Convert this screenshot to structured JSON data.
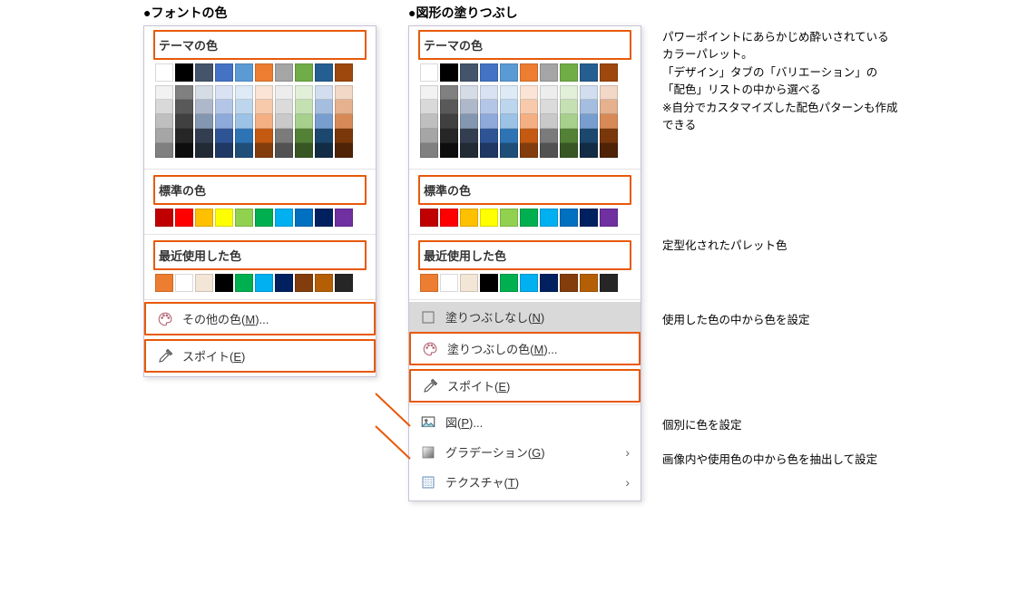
{
  "captions": {
    "font": "フォントの色",
    "fill": "図形の塗りつぶし"
  },
  "sections": {
    "theme": "テーマの色",
    "standard": "標準の色",
    "recent": "最近使用した色"
  },
  "font_menu": {
    "more": "その他の色(<u>M</u>)...",
    "eyedrop": "スポイト(<u>E</u>)"
  },
  "fill_menu": {
    "none": "塗りつぶしなし(<u>N</u>)",
    "more": "塗りつぶしの色(<u>M</u>)...",
    "eyedrop": "スポイト(<u>E</u>)",
    "picture": "図(<u>P</u>)...",
    "gradient": "グラデーション(<u>G</u>)",
    "texture": "テクスチャ(<u>T</u>)"
  },
  "annotations": {
    "theme": "パワーポイントにあらかじめ酔いされているカラーパレット。\n「デザイン」タブの「バリエーション」の「配色」リストの中から選べる\n※自分でカスタマイズした配色パターンも作成できる",
    "standard": "定型化されたパレット色",
    "recent": "使用した色の中から色を設定",
    "more": "個別に色を設定",
    "eyedrop": "画像内や使用色の中から色を抽出して設定"
  },
  "palette": {
    "theme_row": [
      "#ffffff",
      "#000000",
      "#44546a",
      "#4472c4",
      "#5b9bd5",
      "#ed7d31",
      "#a5a5a5",
      "#70ad47",
      "#255e91",
      "#9e480e"
    ],
    "theme_shades": [
      [
        "#f2f2f2",
        "#d9d9d9",
        "#bfbfbf",
        "#a6a6a6",
        "#808080"
      ],
      [
        "#808080",
        "#595959",
        "#404040",
        "#262626",
        "#0d0d0d"
      ],
      [
        "#d6dce5",
        "#adb9ca",
        "#8497b0",
        "#333f50",
        "#222a35"
      ],
      [
        "#d9e2f3",
        "#b4c6e7",
        "#8eaadb",
        "#2f5496",
        "#1f3864"
      ],
      [
        "#deeaf6",
        "#bdd6ee",
        "#9cc2e5",
        "#2e74b5",
        "#1f4e79"
      ],
      [
        "#fbe4d5",
        "#f7caac",
        "#f4b083",
        "#c45911",
        "#833c0b"
      ],
      [
        "#ededed",
        "#dbdbdb",
        "#c9c9c9",
        "#7b7b7b",
        "#525252"
      ],
      [
        "#e2efd9",
        "#c5e0b3",
        "#a8d08d",
        "#538135",
        "#375623"
      ],
      [
        "#d2deef",
        "#a5bedf",
        "#779ecf",
        "#1c476e",
        "#112c44"
      ],
      [
        "#f2d8c6",
        "#e5b18e",
        "#d88a56",
        "#7a370a",
        "#4e2306"
      ]
    ],
    "standard_row": [
      "#c00000",
      "#ff0000",
      "#ffc000",
      "#ffff00",
      "#92d050",
      "#00b050",
      "#00b0f0",
      "#0070c0",
      "#002060",
      "#7030a0"
    ],
    "recent_row": [
      "#ed7d31",
      "#ffffff",
      "#f4e6d6",
      "#000000",
      "#00b050",
      "#00b0f0",
      "#002060",
      "#833c0b",
      "#b45f06",
      "#262626"
    ]
  }
}
